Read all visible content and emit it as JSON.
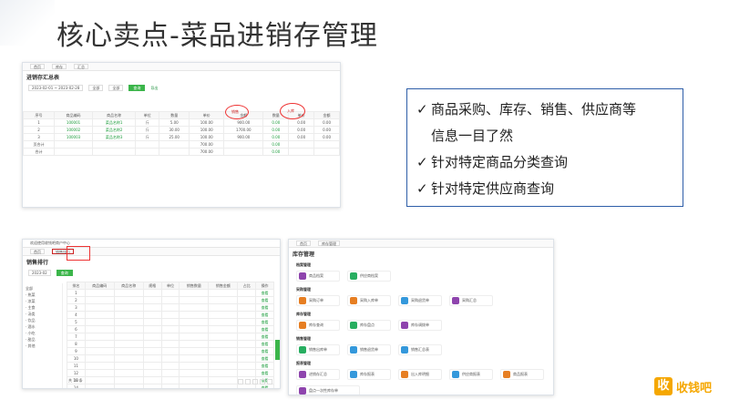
{
  "slide": {
    "title": "核心卖点-菜品进销存管理",
    "features": [
      "商品采购、库存、销售、供应商等",
      "信息一目了然",
      "针对特定商品分类查询",
      "针对特定供应商查询"
    ],
    "check_glyph": "✓",
    "brand": {
      "logo_char": "收",
      "name": "收钱吧"
    }
  },
  "shot1": {
    "page_title": "进销存汇总表",
    "col_label_1": "销售",
    "col_label_2": "入库",
    "query_button": "查询",
    "rows": [
      {
        "no": "1",
        "a": "100001",
        "b": "菜品名称1",
        "c": "斤",
        "d": "5.00",
        "e": "100.00",
        "f": "900.00"
      },
      {
        "no": "2",
        "a": "100002",
        "b": "菜品名称2",
        "c": "斤",
        "d": "30.00",
        "e": "100.00",
        "f": "1700.00"
      },
      {
        "no": "3",
        "a": "100003",
        "b": "菜品名称3",
        "c": "斤",
        "d": "25.00",
        "e": "100.00",
        "f": "900.00"
      }
    ],
    "subtotal_label": "页合计",
    "total_label": "合计",
    "subtotal_value": "700.00",
    "total_value": "700.00"
  },
  "shot2": {
    "header": "欢迎使用收钱吧商户中心",
    "active_tab": "销售排行",
    "page_title": "销售排行",
    "query_button": "查询",
    "row_count": 16,
    "footer": "共 16 条"
  },
  "shot3": {
    "page_title": "库存管理",
    "sections": [
      {
        "name": "档案管理",
        "cards": [
          {
            "label": "商品档案",
            "color": "#8e44ad"
          },
          {
            "label": "供应商档案",
            "color": "#27ae60"
          }
        ]
      },
      {
        "name": "采购管理",
        "cards": [
          {
            "label": "采购订单",
            "color": "#e67e22"
          },
          {
            "label": "采购入库单",
            "color": "#e67e22"
          },
          {
            "label": "采购退货单",
            "color": "#3498db"
          },
          {
            "label": "采购汇总",
            "color": "#8e44ad"
          }
        ]
      },
      {
        "name": "库存管理",
        "cards": [
          {
            "label": "库存查询",
            "color": "#e67e22"
          },
          {
            "label": "库存盘点",
            "color": "#27ae60"
          },
          {
            "label": "库存调拨单",
            "color": "#8e44ad"
          }
        ]
      },
      {
        "name": "销售管理",
        "cards": [
          {
            "label": "销售出库单",
            "color": "#27ae60"
          },
          {
            "label": "销售退货单",
            "color": "#3498db"
          },
          {
            "label": "销售汇总表",
            "color": "#3498db"
          }
        ]
      },
      {
        "name": "报表管理",
        "cards": [
          {
            "label": "进销存汇总",
            "color": "#8e44ad"
          },
          {
            "label": "库存报表",
            "color": "#3498db"
          },
          {
            "label": "出入库明细",
            "color": "#e67e22"
          },
          {
            "label": "供应商报表",
            "color": "#3498db"
          },
          {
            "label": "商品报表",
            "color": "#e67e22"
          }
        ]
      }
    ],
    "extra_card": "盘点一次性库存单"
  }
}
